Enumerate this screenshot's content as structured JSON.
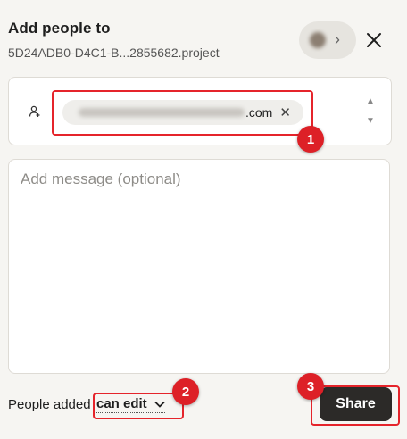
{
  "dialog": {
    "title": "Add people to",
    "subtitle": "5D24ADB0-D4C1-B...2855682.project"
  },
  "recipients": [
    {
      "email_domain": ".com",
      "remove_glyph": "✕"
    }
  ],
  "scroll": {
    "up": "▲",
    "down": "▼"
  },
  "message": {
    "placeholder": "Add message (optional)"
  },
  "footer": {
    "label": "People added",
    "permission": "can edit",
    "share_label": "Share"
  },
  "annotations": [
    {
      "number": "1",
      "target": "recipient-chip"
    },
    {
      "number": "2",
      "target": "permission-select"
    },
    {
      "number": "3",
      "target": "share-button"
    }
  ],
  "icons": {
    "avatar_chevron": "chevron-right-icon",
    "close": "close-icon",
    "add_person": "add-person-icon",
    "permission_chevron": "chevron-down-icon"
  },
  "colors": {
    "background": "#f6f5f2",
    "share_button": "#2c2a28",
    "annotation": "#e5242b"
  }
}
